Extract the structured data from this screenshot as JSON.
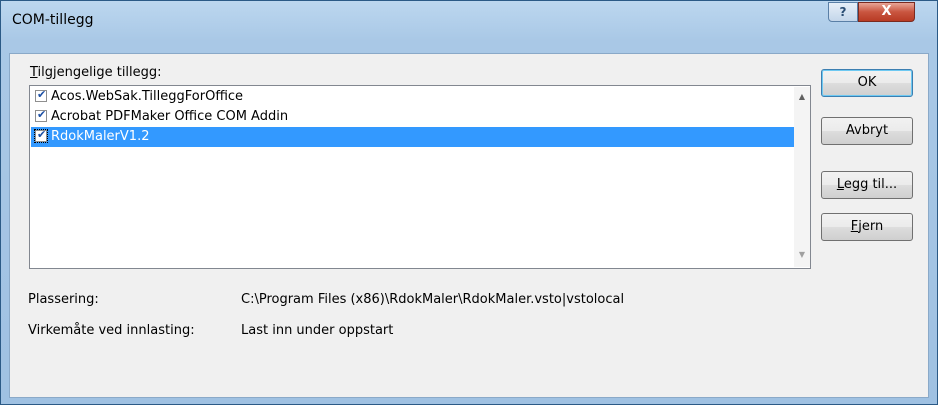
{
  "window": {
    "title": "COM-tillegg",
    "help_label": "?",
    "close_label": "X"
  },
  "addins": {
    "label_mnemonic": "T",
    "label_rest": "ilgjengelige tillegg:",
    "items": [
      {
        "name": "Acos.WebSak.TilleggForOffice",
        "checked": true,
        "selected": false
      },
      {
        "name": "Acrobat PDFMaker Office COM Addin",
        "checked": true,
        "selected": false
      },
      {
        "name": "RdokMalerV1.2",
        "checked": true,
        "selected": true
      }
    ]
  },
  "buttons": {
    "ok": "OK",
    "cancel": "Avbryt",
    "add_mnemonic": "L",
    "add_rest": "egg til...",
    "remove_mnemonic": "F",
    "remove_rest": "jern"
  },
  "info": {
    "location_label": "Plassering:",
    "location_value": "C:\\Program Files (x86)\\RdokMaler\\RdokMaler.vsto|vstolocal",
    "load_label": "Virkemåte ved innlasting:",
    "load_value": "Last inn under oppstart"
  },
  "icons": {
    "check": "checkmark-icon",
    "up": "scroll-up-arrow",
    "down": "scroll-down-arrow"
  },
  "colors": {
    "selection": "#3399ff",
    "close_button": "#c9553f",
    "frame": "#a9c8e6"
  }
}
